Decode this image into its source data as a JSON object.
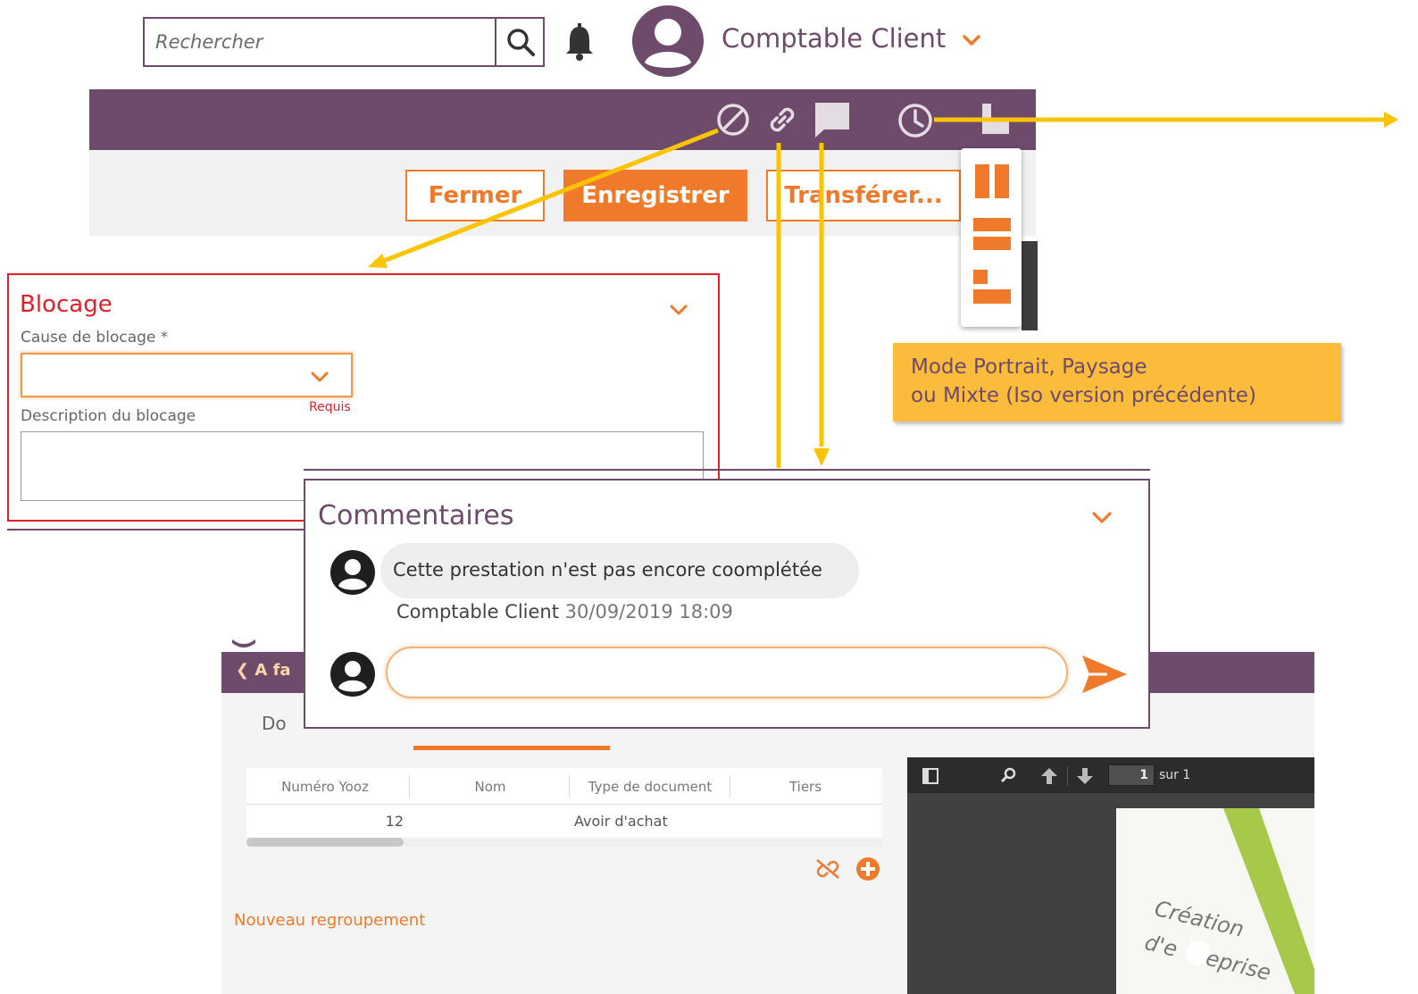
{
  "header": {
    "search": {
      "placeholder": "Rechercher"
    },
    "user": {
      "name": "Comptable Client"
    }
  },
  "toolbar": {
    "icons": [
      "block-icon",
      "link-icon",
      "comment-icon",
      "history-icon",
      "layout-icon"
    ]
  },
  "actions": {
    "close_label": "Fermer",
    "save_label": "Enregistrer",
    "transfer_label": "Transférer..."
  },
  "layout_menu": {
    "options": [
      "portrait-icon",
      "landscape-icon",
      "mixed-icon"
    ]
  },
  "blocage": {
    "title": "Blocage",
    "cause_label": "Cause de blocage *",
    "cause_value": "",
    "required_label": "Requis",
    "description_label": "Description du blocage",
    "description_value": ""
  },
  "note": {
    "line1": "Mode Portrait, Paysage",
    "line2": "ou Mixte (Iso version précédente)"
  },
  "comments": {
    "title": "Commentaires",
    "items": [
      {
        "text": "Cette prestation n'est pas encore coomplétée",
        "author": "Comptable Client",
        "date": "30/09/2019 18:09"
      }
    ],
    "input_value": ""
  },
  "background_app": {
    "back_label": "A fa",
    "tab_label": "Do",
    "table": {
      "headers": [
        "Numéro Yooz",
        "Nom",
        "Type de document",
        "Tiers"
      ],
      "rows": [
        {
          "numero": "12",
          "nom": "",
          "type": "Avoir d'achat",
          "tiers": ""
        }
      ]
    },
    "new_group_label": "Nouveau regroupement",
    "pdf": {
      "page": "1",
      "page_of": "sur 1",
      "content_line1": "Création",
      "content_line2": "d'e",
      "content_line3": "eprise"
    }
  },
  "colors": {
    "brand_purple": "#6e4a6b",
    "accent_orange": "#f07a2b",
    "annotation_yellow": "#fbbc3c",
    "error_red": "#e0202a"
  }
}
